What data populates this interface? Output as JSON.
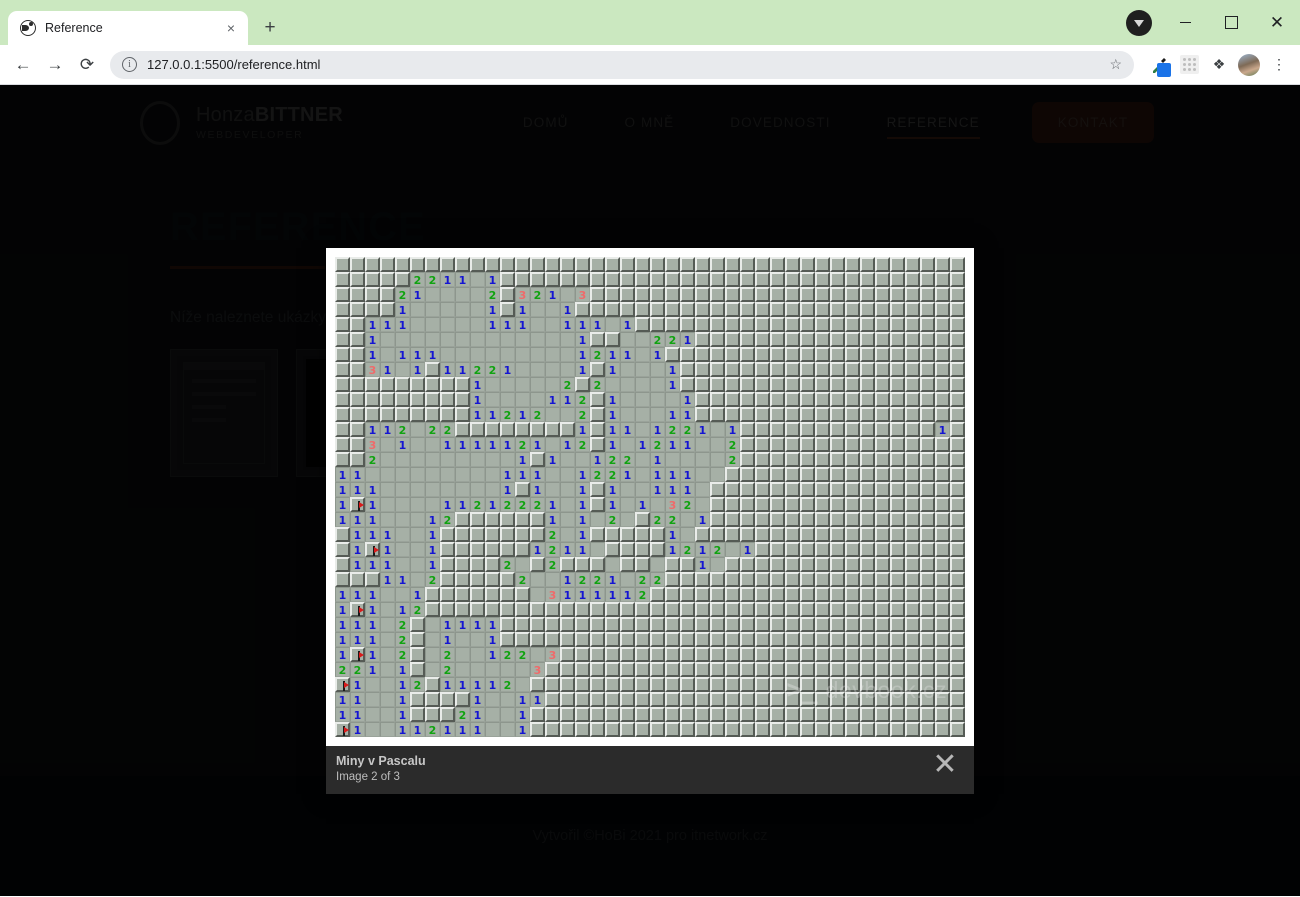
{
  "browser": {
    "tab": {
      "title": "Reference",
      "favicon_icon": "globe-icon",
      "close_icon": "×"
    },
    "new_tab_icon": "+",
    "window": {
      "minimize_icon": "",
      "maximize_icon": "",
      "close_icon": "✕",
      "profile_icon": "profile-chevron-icon"
    },
    "nav": {
      "back_icon": "←",
      "forward_icon": "→",
      "reload_icon": "⟳"
    },
    "omnibox": {
      "info_icon": "i",
      "url": "127.0.0.1:5500/reference.html",
      "star_icon": "☆"
    },
    "toolbar_icons": [
      "eyedropper-icon",
      "apps-grid-icon",
      "extensions-puzzle-icon",
      "avatar-icon",
      "menu-kebab-icon"
    ],
    "kebab_icon": "⋮",
    "puzzle_icon": "❖"
  },
  "site": {
    "logo": {
      "name_light": "Honza",
      "name_bold": "BITTNER",
      "tagline": "WEBDEVELOPER"
    },
    "nav": [
      {
        "label": "DOMŮ",
        "active": false
      },
      {
        "label": "O MNĚ",
        "active": false
      },
      {
        "label": "DOVEDNOSTI",
        "active": false
      },
      {
        "label": "REFERENCE",
        "active": true
      }
    ],
    "cta_label": "KONTAKT",
    "heading": "REFERENCE",
    "lead": "Níže naleznete ukázky",
    "footer": "Vytvořil ©HoBi 2021 pro itnetwork.cz"
  },
  "lightbox": {
    "title": "Miny v Pascalu",
    "counter": "Image 2 of 3",
    "close_icon": "✕",
    "watermark": {
      "icon": ">_",
      "text": "devbook.cz",
      "sub": "programátorská sociální síť"
    }
  },
  "colors": {
    "tabstrip": "#cbe8c0",
    "page_bg": "#0b0d10",
    "accent": "#4a2418",
    "cta_bg": "#321610",
    "number_1": "#1414d2",
    "number_2": "#11a311",
    "number_3": "#ef6b6b",
    "cell_face": "#a6b0a6"
  },
  "minesweeper": {
    "cols": 42,
    "rows": 32,
    "legend": {
      "covered": "c",
      "opened": "o",
      "flag": "F",
      "numbers": "1|2|3"
    },
    "grid": [
      "cccccccccccccccccccccccccccccccccccccccccc",
      "ccccc2211 1cccccccccccccccccccccccccccccccc",
      "cccc21    2c321 3ccccccccccccccccccccccccc",
      "cccc1     1c1  1cccccccccccccccccccccccccc",
      "cc111     111  111 1ccccccccccccccccccccccc",
      "cc1             1cc  221ccccccccccccccccccc",
      "cc1 111         1211 1cccccccccccccccccccc",
      "cc31 1c11221    1c1   1ccccccccccccccccccc",
      "ccccccccc1     2c2    1ccccccccccccccccccc",
      "ccccccccc1    112c1    1cccccccccccccccccc",
      "ccccccccc11212  2c1   11cccccccccccccccccc",
      "cc112 22cccccccc1c11 1221 1ccccccccccccc1c",
      "cc3 1  1111121 12c1 1211  2ccccccccccccccc",
      "cc2         1c1  122 1    2ccccccccccccccc",
      "11         111  1221 111  ccccccccccccccccc",
      "111        1c1  1c1  111 cccccccccccccccccc",
      "1F1    11212221 1c1 1 32 ccccccccccccccccc",
      "111   12cccccc1 1 2 c22 1ccccccccccccccccc",
      "c111  1ccccccc2 1ccccc1 ccccccccccccccccccc",
      "c1F1  1cccccc1211 cccc1212 1cccccccccccccc",
      "c111  1cccc2 c2ccc cc cc1 cccccccccccccccc",
      "ccc11 2ccccc2  1221 22cccccccccccccccccccc",
      "111  1ccccccc 3111112ccccccccccccccccccccc",
      "1F1 12cccccccccccccccccccccccccccccccccccc",
      "111 2c 1111ccccccccccccccccccccccccccccccc",
      "111 2c 1  1cccccccccccccccccccccccccccccccc",
      "1F1 2c 2  122 3cccccccccccccccccccccccccccc",
      "221 1c 2     3ccccccccccccccccccccccccccccc",
      "F1  12c11112 cccccccccccccccccccccccccccccc",
      "11  1cccc1  11cccccccccccccccccccccccccccc",
      "11  1ccc21  1cccccccccccccccccccccccccccccc",
      "F1  112111  1ccccccccccccccccccccccccccccc"
    ]
  }
}
